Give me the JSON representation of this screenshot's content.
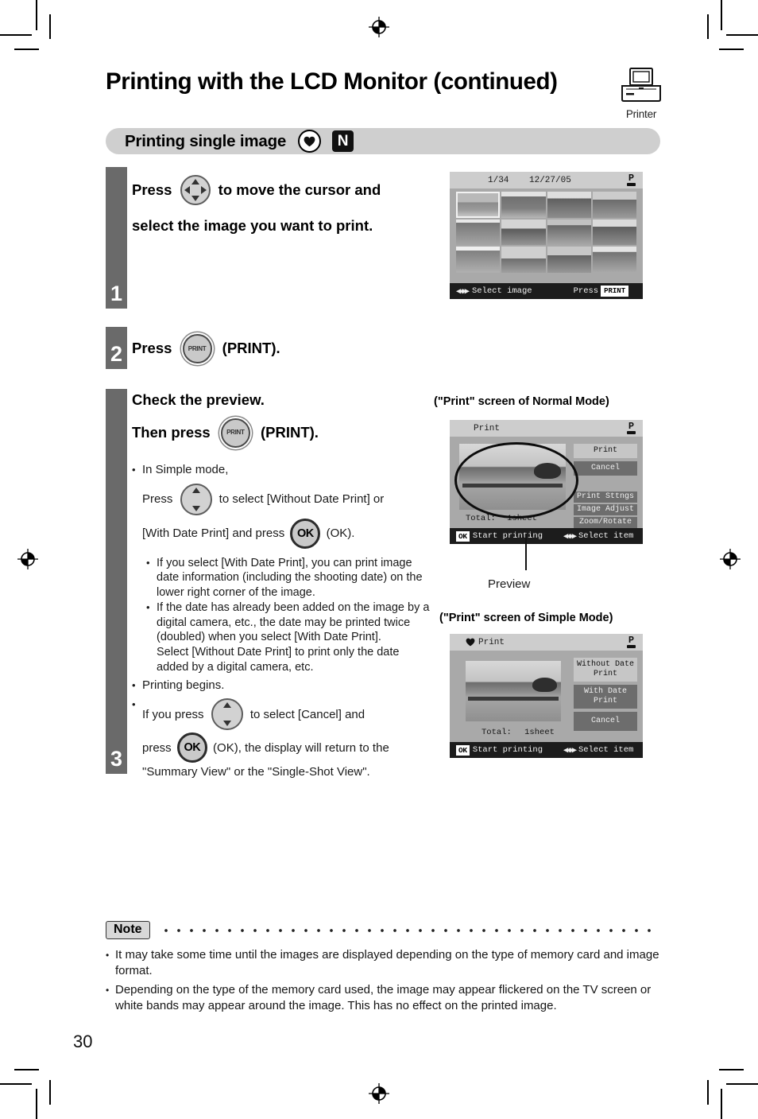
{
  "header": {
    "title": "Printing with the LCD Monitor (continued)",
    "printer_caption": "Printer",
    "printer_icon": "printer-icon"
  },
  "section": {
    "title": "Printing single image",
    "badge_heart": "heart-icon",
    "badge_normal": "N"
  },
  "steps": [
    {
      "number": "1",
      "line1_pre": "Press ",
      "line1_post": " to move the cursor and",
      "line2": "select the image you want to print.",
      "button_icon": "dpad-4way-icon"
    },
    {
      "number": "2",
      "pre": "Press ",
      "post": " (PRINT).",
      "button_icon": "print-button-icon",
      "button_label": "PRINT"
    },
    {
      "number": "3",
      "head_line1": "Check the preview.",
      "head_line2_pre": "Then press ",
      "head_line2_post": " (PRINT).",
      "bullets": {
        "simple_mode_intro": "In Simple mode,",
        "press_pre": "Press ",
        "press_mid": " to select [Without Date Print] or",
        "press_line2_pre": "[With Date Print] and press ",
        "press_line2_post": " (OK).",
        "sub1": "If you select [With Date Print], you can print image date information (including the shooting date) on the lower right corner of the image.",
        "sub2": "If the date has already been added on the image by a digital camera, etc., the date may be printed twice (doubled) when you select [With Date Print].\nSelect [Without Date Print] to print only the date added by a digital camera, etc.",
        "printing_begins": "Printing begins.",
        "cancel_pre": "If you press ",
        "cancel_mid": " to select [Cancel] and",
        "cancel_line2_pre": "press ",
        "cancel_line2_post": " (OK), the display will return to the",
        "cancel_line3": "\"Summary View\" or the \"Single-Shot View\"."
      }
    }
  ],
  "lcd_grid": {
    "counter": "1/34",
    "date": "12/27/05",
    "printer_status_icon": "printer-p-icon",
    "hint_left": "Select image",
    "hint_right": "Press",
    "print_chip": "PRINT",
    "thumbnail_count": 12,
    "selected_index": 0
  },
  "captions": {
    "normal_mode": "(\"Print\" screen of Normal Mode)",
    "simple_mode": "(\"Print\" screen of Simple Mode)",
    "preview": "Preview"
  },
  "lcd_normal": {
    "title": "Print",
    "printer_status_icon": "printer-p-icon",
    "menu_primary": [
      "Print",
      "Cancel"
    ],
    "menu_secondary": [
      "Print Sttngs",
      "Image Adjust",
      "Zoom/Rotate"
    ],
    "total_label": "Total:",
    "total_value": "1sheet",
    "ok_chip": "OK",
    "ok_action": "Start printing",
    "select_hint": "Select item"
  },
  "lcd_simple": {
    "title": "Print",
    "heart_icon": "heart-icon",
    "printer_status_icon": "printer-p-icon",
    "menu": [
      "Without Date\nPrint",
      "With Date\nPrint",
      "Cancel"
    ],
    "total_label": "Total:",
    "total_value": "1sheet",
    "ok_chip": "OK",
    "ok_action": "Start printing",
    "select_hint": "Select item"
  },
  "note": {
    "label": "Note",
    "items": [
      "It may take some time until the images are displayed depending on the type of memory card and image format.",
      "Depending on the type of the memory card used, the image may appear flickered on the TV screen or white bands may appear around the image. This has no effect on the printed image."
    ]
  },
  "page_number": "30",
  "colors": {
    "step_bar": "#6a6a6a",
    "section_bar": "#cfcfcf",
    "lcd_body": "#a9a9a9",
    "lcd_topbar": "#cdcdcd",
    "lcd_botbar": "#1c1c1c"
  }
}
